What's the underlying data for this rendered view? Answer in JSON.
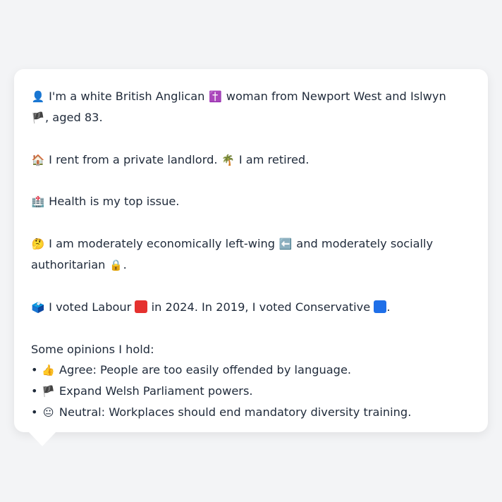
{
  "profile": {
    "line1": {
      "icon": "👤",
      "a": "I'm a white British Anglican",
      "icon2": "✝️",
      "b": "woman from Newport West and Islwyn",
      "icon3": "🏴",
      "c": ", aged 83."
    },
    "line2": {
      "icon": "🏠",
      "a": "I rent from a private landlord.",
      "icon2": "🌴",
      "b": "I am retired."
    },
    "line3": {
      "icon": "🏥",
      "a": "Health is my top issue."
    },
    "line4": {
      "icon": "🤔",
      "a": "I am moderately economically left-wing",
      "icon2": "⬅️",
      "b": "and moderately socially authoritarian",
      "icon3": "🔒",
      "c": "."
    },
    "line5": {
      "icon": "🗳️",
      "a": "I voted Labour",
      "b": "in 2024. In 2019, I voted Conservative",
      "c": "."
    },
    "opinions_heading": "Some opinions I hold:",
    "opinions": [
      {
        "bullet": "•",
        "icon": "👍",
        "text": "Agree: People are too easily offended by language."
      },
      {
        "bullet": "•",
        "icon": "🏴",
        "text": "Expand Welsh Parliament powers."
      },
      {
        "bullet": "•",
        "icon": "😐",
        "text": "Neutral: Workplaces should end mandatory diversity training."
      }
    ]
  },
  "colors": {
    "labour": "#e5312f",
    "conservative": "#1f6fe8"
  }
}
